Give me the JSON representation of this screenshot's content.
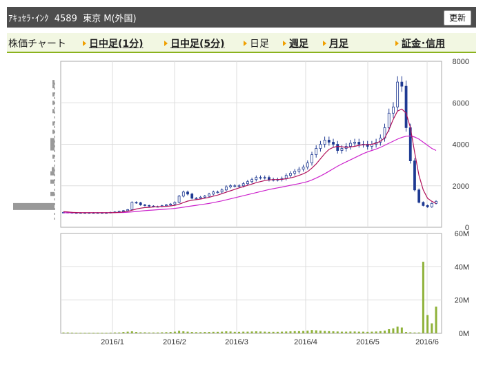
{
  "header": {
    "title": "ｱｷｭｾﾗ･ｲﾝｸ  4589  東京 M(外国)",
    "refresh_label": "更新"
  },
  "nav": {
    "chart_label": "株価チャート",
    "intraday_1m": "日中足(1分)",
    "intraday_5m": "日中足(5分)",
    "daily": "日足",
    "weekly": "週足",
    "monthly": "月足",
    "margin": "証金･信用"
  },
  "colors": {
    "up_candle": "#ffffff",
    "down_candle": "#1f3a93",
    "ma_short": "#b0105a",
    "ma_long": "#cc22cc",
    "volume_bar": "#8fb23a",
    "volume_profile": "#999999"
  },
  "chart_data": {
    "type": "candlestick+volume",
    "x_tick_labels": [
      "2016/1",
      "2016/2",
      "2016/3",
      "2016/4",
      "2016/5",
      "2016/6"
    ],
    "price_axis": {
      "ticks": [
        "8000",
        "6000",
        "4000",
        "2000",
        "0"
      ],
      "ylim": [
        0,
        8000
      ]
    },
    "volume_axis": {
      "ticks": [
        "60M",
        "40M",
        "20M",
        "0M"
      ],
      "ylim": [
        0,
        60
      ]
    },
    "daily_close": [
      720,
      710,
      700,
      700,
      690,
      700,
      700,
      690,
      700,
      700,
      700,
      720,
      740,
      770,
      800,
      850,
      1200,
      1180,
      1080,
      1050,
      1020,
      1000,
      1000,
      1040,
      1080,
      1120,
      1200,
      1500,
      1700,
      1600,
      1400,
      1400,
      1450,
      1500,
      1600,
      1700,
      1700,
      1800,
      1950,
      2000,
      2000,
      2000,
      2100,
      2200,
      2300,
      2400,
      2400,
      2400,
      2300,
      2300,
      2300,
      2350,
      2500,
      2600,
      2700,
      2800,
      2900,
      3100,
      3500,
      3800,
      4000,
      4200,
      4100,
      4000,
      3700,
      3800,
      3900,
      4050,
      4100,
      4000,
      4000,
      3900,
      4000,
      4100,
      4300,
      4800,
      5500,
      5800,
      7000,
      6800,
      4800,
      3200,
      1800,
      1200,
      1050,
      980,
      1150,
      1250
    ],
    "ma_short": [
      750,
      740,
      720,
      710,
      700,
      700,
      700,
      700,
      700,
      700,
      700,
      700,
      710,
      720,
      740,
      770,
      820,
      880,
      920,
      950,
      960,
      980,
      990,
      1000,
      1010,
      1030,
      1060,
      1110,
      1190,
      1260,
      1300,
      1330,
      1360,
      1400,
      1440,
      1500,
      1550,
      1620,
      1690,
      1760,
      1830,
      1900,
      1960,
      2020,
      2080,
      2150,
      2200,
      2250,
      2280,
      2300,
      2300,
      2310,
      2340,
      2380,
      2430,
      2500,
      2580,
      2680,
      2850,
      3050,
      3300,
      3550,
      3750,
      3850,
      3900,
      3880,
      3850,
      3870,
      3900,
      3950,
      3980,
      3980,
      4000,
      4050,
      4150,
      4300,
      4700,
      5200,
      5600,
      5700,
      5500,
      4800,
      3600,
      2500,
      1800,
      1400,
      1250,
      1150
    ],
    "ma_long": [
      700,
      700,
      700,
      700,
      700,
      700,
      700,
      700,
      700,
      700,
      700,
      700,
      705,
      710,
      715,
      725,
      740,
      760,
      780,
      800,
      815,
      830,
      845,
      860,
      875,
      890,
      910,
      935,
      965,
      1000,
      1030,
      1060,
      1090,
      1120,
      1150,
      1190,
      1230,
      1270,
      1320,
      1370,
      1420,
      1470,
      1520,
      1570,
      1620,
      1670,
      1720,
      1770,
      1820,
      1860,
      1900,
      1940,
      1980,
      2020,
      2060,
      2100,
      2150,
      2200,
      2280,
      2370,
      2470,
      2580,
      2700,
      2820,
      2940,
      3050,
      3150,
      3250,
      3350,
      3450,
      3550,
      3630,
      3700,
      3770,
      3850,
      3950,
      4050,
      4150,
      4250,
      4330,
      4390,
      4400,
      4350,
      4250,
      4100,
      3950,
      3800,
      3700
    ],
    "volume_m": [
      0.5,
      0.5,
      0.4,
      0.3,
      0.3,
      0.3,
      0.3,
      0.3,
      0.3,
      0.3,
      0.3,
      0.4,
      0.5,
      0.5,
      0.8,
      1.0,
      1.2,
      0.8,
      0.6,
      0.6,
      0.5,
      0.5,
      0.5,
      0.6,
      0.7,
      0.8,
      1.0,
      1.5,
      1.2,
      1.0,
      0.8,
      0.7,
      0.7,
      0.8,
      0.8,
      0.9,
      0.9,
      1.0,
      1.2,
      1.1,
      0.9,
      0.9,
      1.0,
      1.0,
      1.1,
      1.2,
      1.1,
      1.0,
      0.9,
      0.9,
      0.9,
      1.0,
      1.1,
      1.2,
      1.3,
      1.3,
      1.4,
      1.6,
      2.0,
      1.8,
      1.6,
      1.4,
      1.3,
      1.2,
      1.1,
      1.0,
      1.0,
      1.1,
      1.1,
      1.0,
      1.0,
      0.9,
      1.0,
      1.1,
      1.3,
      1.6,
      2.5,
      3.0,
      4.0,
      3.5,
      0.8,
      0.6,
      0.5,
      0.5,
      43,
      11,
      6,
      16
    ]
  }
}
